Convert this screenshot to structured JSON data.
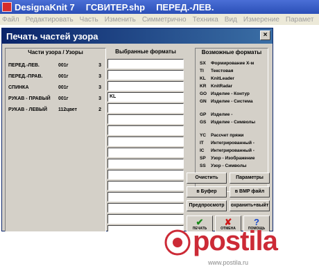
{
  "app": {
    "title_parts": [
      "DesignaKnit 7",
      "ГСВИТЕР.shp",
      "ПЕРЕД.-ЛЕВ."
    ]
  },
  "menu": [
    "Файл",
    "Редактировать",
    "Часть",
    "Изменить",
    "Симметрично",
    "Техника",
    "Вид",
    "Измерение",
    "Парамет"
  ],
  "dialog": {
    "title": "Печать частей узора",
    "close": "×",
    "parts_header": "Части узора / Узоры",
    "selected_header": "Выбранные форматы",
    "formats_header": "Возможные форматы",
    "parts": [
      {
        "name": "ПЕРЕД.-ЛЕВ.",
        "format": "001г",
        "count": "3"
      },
      {
        "name": "ПЕРЕД.-ПРАВ.",
        "format": "001г",
        "count": "3"
      },
      {
        "name": "СПИНКА",
        "format": "001г",
        "count": "3"
      },
      {
        "name": "РУКАВ - ПРАВЫЙ",
        "format": "001г",
        "count": "3"
      },
      {
        "name": "РУКАВ - ЛЕВЫЙ",
        "format": "112цвет",
        "count": "2"
      }
    ],
    "selected": [
      "",
      "",
      "",
      "KL",
      "",
      "",
      "",
      "",
      "",
      "",
      "",
      "",
      "",
      "",
      "",
      "",
      ""
    ],
    "formats": [
      {
        "code": "SX",
        "label": "Формирование Х-м"
      },
      {
        "code": "TI",
        "label": "Текстовая"
      },
      {
        "code": "KL",
        "label": "KnitLeader"
      },
      {
        "code": "KR",
        "label": "KnitRadar"
      },
      {
        "code": "GO",
        "label": "Изделие - Контур"
      },
      {
        "code": "GN",
        "label": "Изделие - Система"
      },
      {
        "code": "GP",
        "label": "Изделие -"
      },
      {
        "code": "GS",
        "label": "Изделие - Символы"
      },
      {
        "code": "YC",
        "label": "Рассчет пряжи"
      },
      {
        "code": "IT",
        "label": "Интегрированный -"
      },
      {
        "code": "IC",
        "label": "Интегрированный -"
      },
      {
        "code": "SP",
        "label": "Узор - Изображение"
      },
      {
        "code": "SS",
        "label": "Узор - Символы"
      }
    ],
    "buttons": {
      "clear": "Очистить",
      "params": "Параметры",
      "to_buffer": "в Буфер",
      "to_bmp": "в BMP файл",
      "preview": "Предпросмотр",
      "save_exit": "охранить+выйт",
      "print": "ПЕЧАТЬ",
      "cancel": "ОТМЕНА",
      "help": "ПОМОЩЬ"
    }
  },
  "background": {
    "brand": "postila",
    "url": "www.postila.ru"
  },
  "colors": {
    "title_bar": "#2b4fb7",
    "dialog_title": "#0a246a",
    "dialog_bg": "#d4d0c8",
    "brand_red": "#cc2a36"
  }
}
